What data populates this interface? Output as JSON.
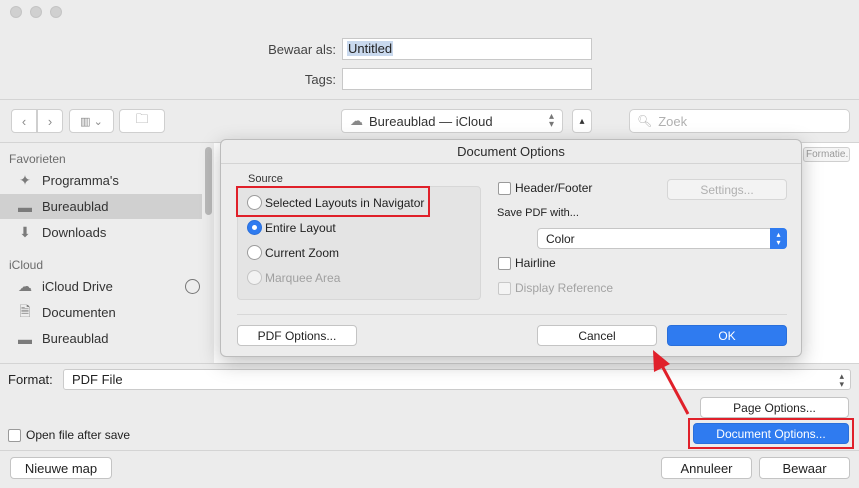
{
  "save_panel": {
    "save_as_label": "Bewaar als:",
    "save_as_value": "Untitled",
    "tags_label": "Tags:",
    "tags_value": "",
    "location": "Bureaublad — iCloud",
    "search_placeholder": "Zoek",
    "peek_button": "Formatie..."
  },
  "sidebar": {
    "favorites_header": "Favorieten",
    "favorites": [
      {
        "label": "Programma's",
        "icon": "apps-icon"
      },
      {
        "label": "Bureaublad",
        "icon": "desktop-icon",
        "active": true
      },
      {
        "label": "Downloads",
        "icon": "download-icon"
      }
    ],
    "icloud_header": "iCloud",
    "icloud": [
      {
        "label": "iCloud Drive",
        "icon": "cloud-icon"
      },
      {
        "label": "Documenten",
        "icon": "document-icon"
      },
      {
        "label": "Bureaublad",
        "icon": "desktop-icon"
      }
    ]
  },
  "bottom": {
    "format_label": "Format:",
    "format_value": "PDF File",
    "page_options": "Page Options...",
    "document_options": "Document Options...",
    "open_after_save": "Open file after save",
    "new_folder": "Nieuwe map",
    "cancel": "Annuleer",
    "save": "Bewaar"
  },
  "dialog": {
    "title": "Document Options",
    "source_title": "Source",
    "source_options": [
      {
        "label": "Selected Layouts in Navigator",
        "selected": false,
        "enabled": true
      },
      {
        "label": "Entire Layout",
        "selected": true,
        "enabled": true
      },
      {
        "label": "Current Zoom",
        "selected": false,
        "enabled": true
      },
      {
        "label": "Marquee Area",
        "selected": false,
        "enabled": false
      }
    ],
    "header_footer": "Header/Footer",
    "settings": "Settings...",
    "save_pdf_with": "Save PDF with...",
    "save_pdf_value": "Color",
    "hairline": "Hairline",
    "display_reference": "Display Reference",
    "pdf_options": "PDF Options...",
    "cancel": "Cancel",
    "ok": "OK"
  },
  "colors": {
    "accent": "#2f7bf0",
    "highlight": "#e0202a"
  }
}
